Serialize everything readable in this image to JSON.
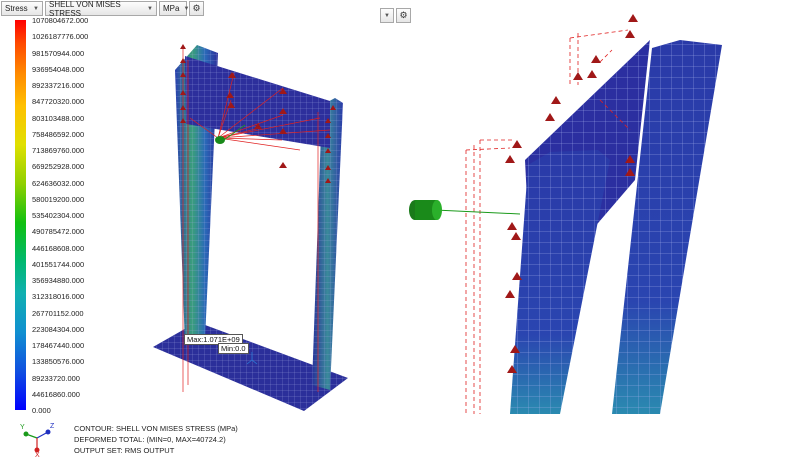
{
  "toolbar": {
    "result_type": "Stress",
    "component": "SHELL VON MISES STRESS",
    "units": "MPa",
    "options_icon": "gear-icon"
  },
  "view2_toolbar": {
    "options_icon": "gear-icon"
  },
  "legend": {
    "values": [
      "1070804672.000",
      "1026187776.000",
      "981570944.000",
      "936954048.000",
      "892337216.000",
      "847720320.000",
      "803103488.000",
      "758486592.000",
      "713869760.000",
      "669252928.000",
      "624636032.000",
      "580019200.000",
      "535402304.000",
      "490785472.000",
      "446168608.000",
      "401551744.000",
      "356934880.000",
      "312318016.000",
      "267701152.000",
      "223084304.000",
      "178467440.000",
      "133850576.000",
      "89233720.000",
      "44616860.000",
      "0.000"
    ],
    "colors": {
      "max": "#ff0000",
      "mid": "#10c010",
      "min": "#0000ff"
    }
  },
  "annotations": {
    "max_label": "Max:1.071E+09",
    "min_label": "Min:0.0"
  },
  "info": {
    "line1": "CONTOUR: SHELL VON MISES STRESS (MPa)",
    "line2": "DEFORMED TOTAL: (MIN=0, MAX=40724.2)",
    "line3": "OUTPUT SET: RMS OUTPUT"
  },
  "triad": {
    "x": "X",
    "y": "Y",
    "z": "Z"
  }
}
